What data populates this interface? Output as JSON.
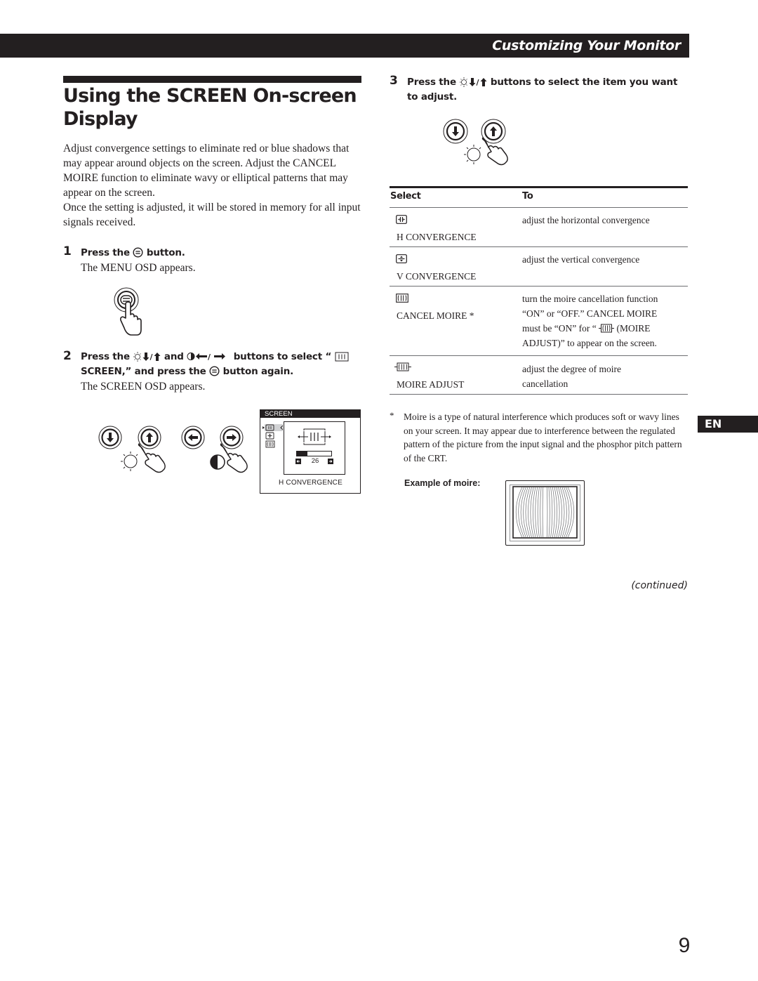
{
  "header": {
    "section_title": "Customizing Your Monitor"
  },
  "title": "Using the SCREEN On-screen Display",
  "title_lines": [
    "Using the SCREEN On-screen",
    "Display"
  ],
  "intro": {
    "paragraph1": "Adjust convergence settings to eliminate red or blue shadows that may appear around objects on the screen. Adjust the CANCEL MOIRE function to eliminate wavy or elliptical patterns that may appear on the screen.",
    "paragraph2": "Once the setting is adjusted, it will be stored in memory for all input signals received."
  },
  "steps": [
    {
      "number": "1",
      "heading_pre": "Press the",
      "heading_post": "button.",
      "result": "The MENU OSD appears."
    },
    {
      "number": "2",
      "heading_a": "Press the",
      "heading_b": "and",
      "heading_c": "buttons to select “",
      "heading_d": "SCREEN,” and press the",
      "heading_e": "button again.",
      "result": "The SCREEN OSD appears."
    },
    {
      "number": "3",
      "heading_pre": "Press the",
      "heading_post": "buttons to select the item you want to adjust.",
      "heading_line1": "buttons to select the item you want",
      "heading_line2": "to adjust."
    }
  ],
  "osd": {
    "title": "SCREEN",
    "value": "26",
    "level_fraction": 0.3,
    "selected_item": "H CONVERGENCE",
    "menu_icons": [
      "h-convergence-icon",
      "v-convergence-icon",
      "cancel-moire-icon"
    ]
  },
  "table": {
    "headers": {
      "select": "Select",
      "to": "To"
    },
    "rows": [
      {
        "icon": "h-convergence-icon",
        "name": "H CONVERGENCE",
        "description": [
          "adjust the horizontal convergence"
        ]
      },
      {
        "icon": "v-convergence-icon",
        "name": "V CONVERGENCE",
        "description": [
          "adjust the vertical convergence"
        ]
      },
      {
        "icon": "cancel-moire-icon",
        "name": "CANCEL MOIRE *",
        "description": [
          "turn the moire cancellation function",
          "“ON” or “OFF.” CANCEL MOIRE",
          "must be “ON” for “",
          "(MOIRE",
          "ADJUST)” to appear on the screen."
        ]
      },
      {
        "icon": "moire-adjust-icon",
        "name": "MOIRE ADJUST",
        "description": [
          "adjust the degree of moire",
          "cancellation"
        ]
      }
    ]
  },
  "footnote": {
    "marker": "*",
    "text": "Moire is a type of natural interference which produces soft or wavy lines on your screen. It may appear due to interference between the regulated pattern of the picture from the input signal and the phosphor pitch pattern of the CRT."
  },
  "moire_example_label": "Example of moire:",
  "continued": "(continued)",
  "language_tab": "EN",
  "page_number": "9",
  "colors": {
    "ink": "#231f20",
    "rule_gray": "#6d6e71",
    "paper": "#ffffff"
  }
}
